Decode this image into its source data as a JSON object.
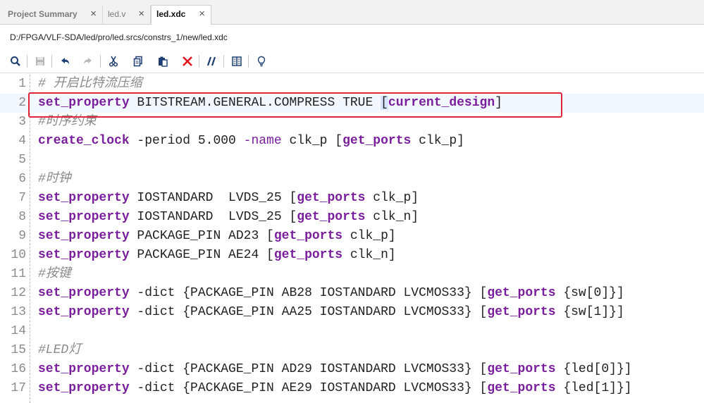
{
  "tabs": [
    {
      "label": "Project Summary",
      "active": false
    },
    {
      "label": "led.v",
      "active": false
    },
    {
      "label": "led.xdc",
      "active": true
    }
  ],
  "file_path": "D:/FPGA/VLF-SDA/led/pro/led.srcs/constrs_1/new/led.xdc",
  "toolbar": [
    "search-icon",
    "save-icon",
    "undo-icon",
    "redo-icon",
    "cut-icon",
    "copy-icon",
    "paste-icon",
    "delete-icon",
    "comment-icon",
    "columns-icon",
    "lightbulb-icon"
  ],
  "colors": {
    "keyword": "#7a1f9c",
    "comment": "#8b8b8b",
    "highlight_box": "#e0253a"
  },
  "lines": [
    {
      "n": "1",
      "parts": [
        [
          "cm",
          "# 开启比特流压缩"
        ]
      ]
    },
    {
      "n": "2",
      "parts": [
        [
          "kw",
          "set_property"
        ],
        [
          "",
          " BITSTREAM.GENERAL.COMPRESS TRUE "
        ],
        [
          "bk",
          "["
        ],
        [
          "kw",
          "current_design"
        ],
        [
          "",
          "]"
        ]
      ]
    },
    {
      "n": "3",
      "parts": [
        [
          "cm",
          "#时序约束"
        ]
      ]
    },
    {
      "n": "4",
      "parts": [
        [
          "kw",
          "create_clock"
        ],
        [
          "",
          " -period 5.000 "
        ],
        [
          "opt",
          "-name"
        ],
        [
          "",
          " clk_p ["
        ],
        [
          "kw",
          "get_ports"
        ],
        [
          "",
          " clk_p]"
        ]
      ]
    },
    {
      "n": "5",
      "parts": []
    },
    {
      "n": "6",
      "parts": [
        [
          "cm",
          "#时钟"
        ]
      ]
    },
    {
      "n": "7",
      "parts": [
        [
          "kw",
          "set_property"
        ],
        [
          "",
          " IOSTANDARD  LVDS_25 ["
        ],
        [
          "kw",
          "get_ports"
        ],
        [
          "",
          " clk_p]"
        ]
      ]
    },
    {
      "n": "8",
      "parts": [
        [
          "kw",
          "set_property"
        ],
        [
          "",
          " IOSTANDARD  LVDS_25 ["
        ],
        [
          "kw",
          "get_ports"
        ],
        [
          "",
          " clk_n]"
        ]
      ]
    },
    {
      "n": "9",
      "parts": [
        [
          "kw",
          "set_property"
        ],
        [
          "",
          " PACKAGE_PIN AD23 ["
        ],
        [
          "kw",
          "get_ports"
        ],
        [
          "",
          " clk_p]"
        ]
      ]
    },
    {
      "n": "10",
      "parts": [
        [
          "kw",
          "set_property"
        ],
        [
          "",
          " PACKAGE_PIN AE24 ["
        ],
        [
          "kw",
          "get_ports"
        ],
        [
          "",
          " clk_n]"
        ]
      ]
    },
    {
      "n": "11",
      "parts": [
        [
          "cm",
          "#按键"
        ]
      ]
    },
    {
      "n": "12",
      "parts": [
        [
          "kw",
          "set_property"
        ],
        [
          "",
          " -dict {PACKAGE_PIN AB28 IOSTANDARD LVCMOS33} ["
        ],
        [
          "kw",
          "get_ports"
        ],
        [
          "",
          " {sw[0]}]"
        ]
      ]
    },
    {
      "n": "13",
      "parts": [
        [
          "kw",
          "set_property"
        ],
        [
          "",
          " -dict {PACKAGE_PIN AA25 IOSTANDARD LVCMOS33} ["
        ],
        [
          "kw",
          "get_ports"
        ],
        [
          "",
          " {sw[1]}]"
        ]
      ]
    },
    {
      "n": "14",
      "parts": []
    },
    {
      "n": "15",
      "parts": [
        [
          "cm",
          "#LED灯"
        ]
      ]
    },
    {
      "n": "16",
      "parts": [
        [
          "kw",
          "set_property"
        ],
        [
          "",
          " -dict {PACKAGE_PIN AD29 IOSTANDARD LVCMOS33} ["
        ],
        [
          "kw",
          "get_ports"
        ],
        [
          "",
          " {led[0]}]"
        ]
      ]
    },
    {
      "n": "17",
      "parts": [
        [
          "kw",
          "set_property"
        ],
        [
          "",
          " -dict {PACKAGE_PIN AE29 IOSTANDARD LVCMOS33} ["
        ],
        [
          "kw",
          "get_ports"
        ],
        [
          "",
          " {led[1]}]"
        ]
      ]
    }
  ]
}
